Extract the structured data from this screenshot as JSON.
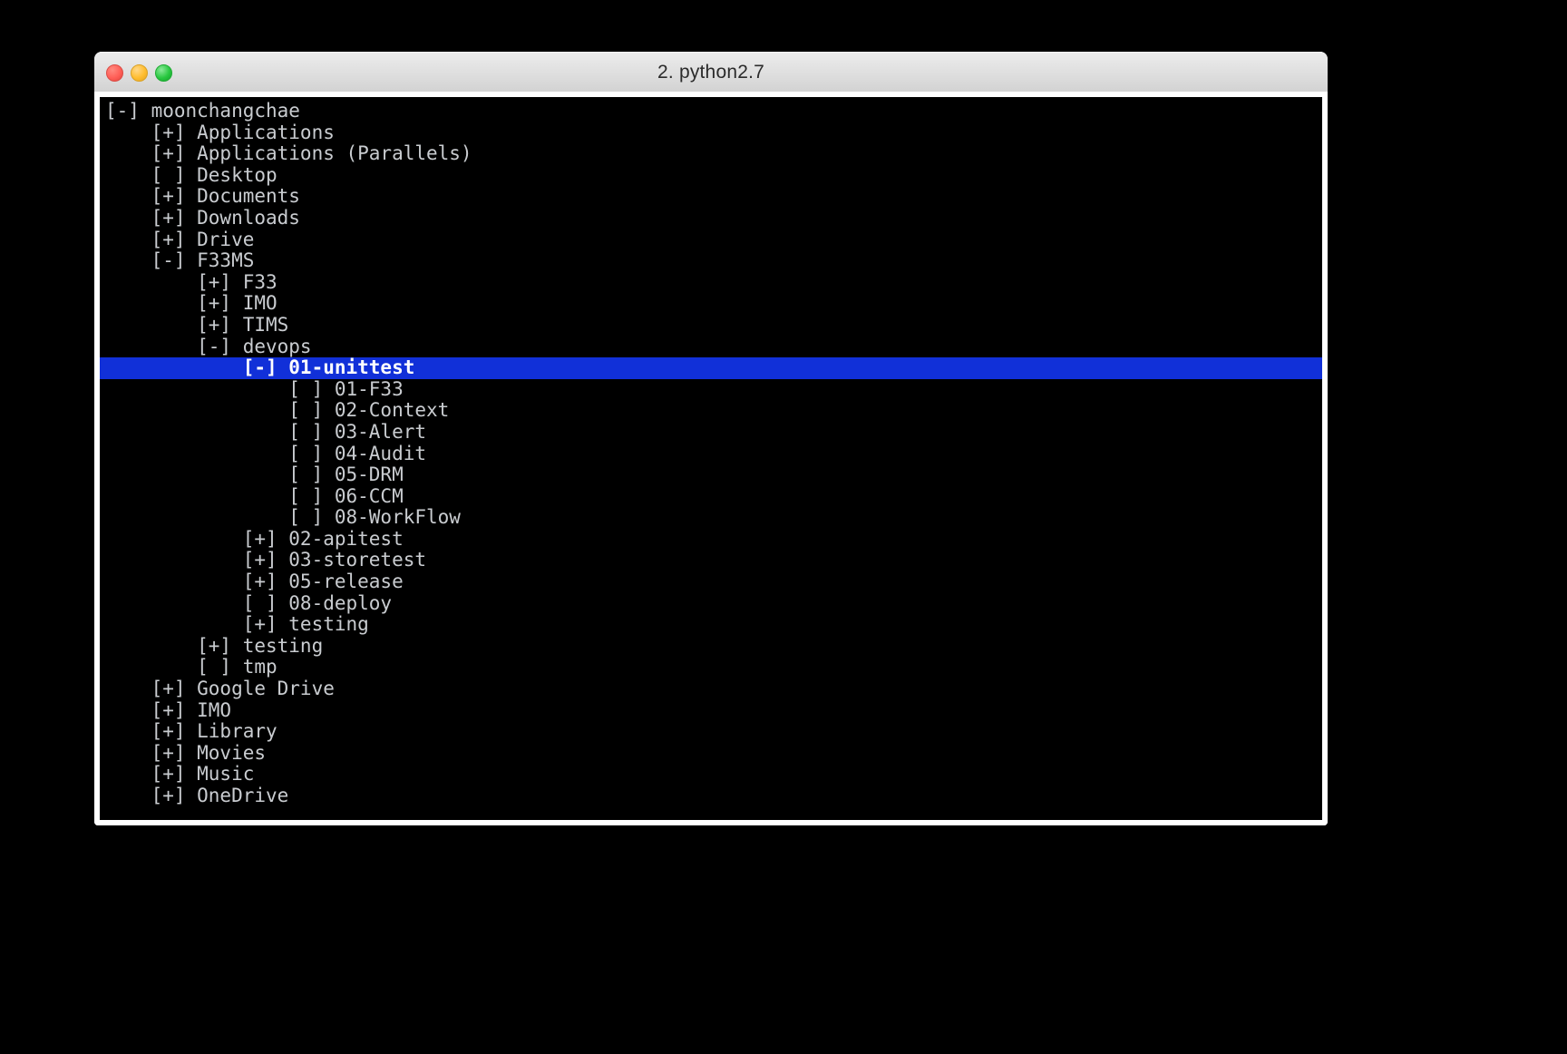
{
  "window": {
    "title": "2. python2.7",
    "controls": [
      {
        "name": "close",
        "color": "#ff5f57"
      },
      {
        "name": "minimize",
        "color": "#ffbd2e"
      },
      {
        "name": "zoom",
        "color": "#28c840"
      }
    ]
  },
  "terminal": {
    "background": "#000000",
    "foreground": "#c9ccd0",
    "selection_background": "#1130d8",
    "selection_foreground": "#ffffff",
    "markers": {
      "expanded": "[-]",
      "collapsed": "[+]",
      "leaf": "[ ]"
    },
    "rows": [
      {
        "indent": 0,
        "marker": "[-]",
        "label": "moonchangchae",
        "selected": false
      },
      {
        "indent": 1,
        "marker": "[+]",
        "label": "Applications",
        "selected": false
      },
      {
        "indent": 1,
        "marker": "[+]",
        "label": "Applications (Parallels)",
        "selected": false
      },
      {
        "indent": 1,
        "marker": "[ ]",
        "label": "Desktop",
        "selected": false
      },
      {
        "indent": 1,
        "marker": "[+]",
        "label": "Documents",
        "selected": false
      },
      {
        "indent": 1,
        "marker": "[+]",
        "label": "Downloads",
        "selected": false
      },
      {
        "indent": 1,
        "marker": "[+]",
        "label": "Drive",
        "selected": false
      },
      {
        "indent": 1,
        "marker": "[-]",
        "label": "F33MS",
        "selected": false
      },
      {
        "indent": 2,
        "marker": "[+]",
        "label": "F33",
        "selected": false
      },
      {
        "indent": 2,
        "marker": "[+]",
        "label": "IMO",
        "selected": false
      },
      {
        "indent": 2,
        "marker": "[+]",
        "label": "TIMS",
        "selected": false
      },
      {
        "indent": 2,
        "marker": "[-]",
        "label": "devops",
        "selected": false
      },
      {
        "indent": 3,
        "marker": "[-]",
        "label": "01-unittest",
        "selected": true
      },
      {
        "indent": 4,
        "marker": "[ ]",
        "label": "01-F33",
        "selected": false
      },
      {
        "indent": 4,
        "marker": "[ ]",
        "label": "02-Context",
        "selected": false
      },
      {
        "indent": 4,
        "marker": "[ ]",
        "label": "03-Alert",
        "selected": false
      },
      {
        "indent": 4,
        "marker": "[ ]",
        "label": "04-Audit",
        "selected": false
      },
      {
        "indent": 4,
        "marker": "[ ]",
        "label": "05-DRM",
        "selected": false
      },
      {
        "indent": 4,
        "marker": "[ ]",
        "label": "06-CCM",
        "selected": false
      },
      {
        "indent": 4,
        "marker": "[ ]",
        "label": "08-WorkFlow",
        "selected": false
      },
      {
        "indent": 3,
        "marker": "[+]",
        "label": "02-apitest",
        "selected": false
      },
      {
        "indent": 3,
        "marker": "[+]",
        "label": "03-storetest",
        "selected": false
      },
      {
        "indent": 3,
        "marker": "[+]",
        "label": "05-release",
        "selected": false
      },
      {
        "indent": 3,
        "marker": "[ ]",
        "label": "08-deploy",
        "selected": false
      },
      {
        "indent": 3,
        "marker": "[+]",
        "label": "testing",
        "selected": false
      },
      {
        "indent": 2,
        "marker": "[+]",
        "label": "testing",
        "selected": false
      },
      {
        "indent": 2,
        "marker": "[ ]",
        "label": "tmp",
        "selected": false
      },
      {
        "indent": 1,
        "marker": "[+]",
        "label": "Google Drive",
        "selected": false
      },
      {
        "indent": 1,
        "marker": "[+]",
        "label": "IMO",
        "selected": false
      },
      {
        "indent": 1,
        "marker": "[+]",
        "label": "Library",
        "selected": false
      },
      {
        "indent": 1,
        "marker": "[+]",
        "label": "Movies",
        "selected": false
      },
      {
        "indent": 1,
        "marker": "[+]",
        "label": "Music",
        "selected": false
      },
      {
        "indent": 1,
        "marker": "[+]",
        "label": "OneDrive",
        "selected": false
      }
    ]
  }
}
